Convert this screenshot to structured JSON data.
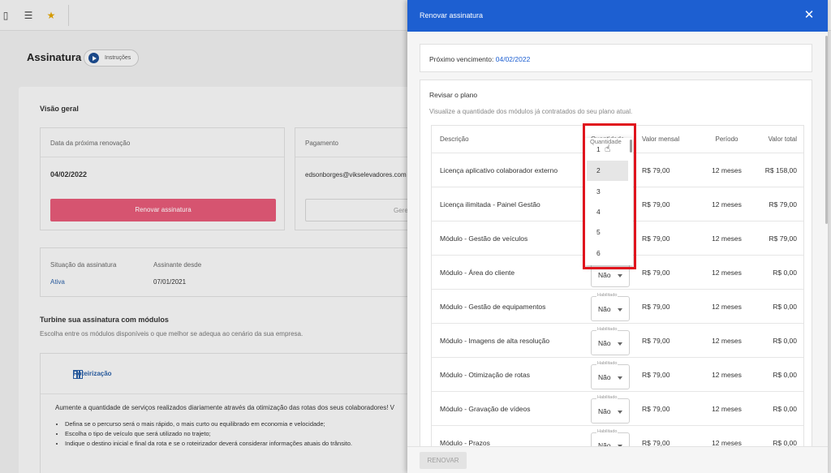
{
  "background": {
    "page_title": "Assinatura",
    "instructions_label": "Instruções",
    "overview": {
      "title": "Visão geral",
      "renewal_header": "Data da próxima renovação",
      "renewal_date": "04/02/2022",
      "renew_button": "Renovar assinatura",
      "payment_header": "Pagamento",
      "payment_email": "edsonborges@vikselevadores.com",
      "payment_button": "Gere"
    },
    "status": {
      "status_label": "Situação da assinatura",
      "status_value": "Ativa",
      "since_label": "Assinante desde",
      "since_value": "07/01/2021"
    },
    "modules": {
      "title": "Turbine sua assinatura com módulos",
      "subtitle": "Escolha entre os módulos disponíveis o que melhor se adequa ao cenário da sua empresa.",
      "routing_title": "Roteirização",
      "routing_desc": "Aumente a quantidade de serviços realizados diariamente através da otimização das rotas dos seus colaboradores! V",
      "bullets": [
        "Defina se o percurso será o mais rápido, o mais curto ou equilibrado em economia e velocidade;",
        "Escolha o tipo de veículo que será utilizado no trajeto;",
        "Indique o destino inicial e final da rota e se o roteirizador deverá considerar informações atuais do trânsito."
      ]
    }
  },
  "modal": {
    "title": "Renovar assinatura",
    "next_due_label": "Próximo vencimento:",
    "next_due_value": "04/02/2022",
    "review_title": "Revisar o plano",
    "review_subtitle": "Visualize a quantidade dos módulos já contratados do seu plano atual.",
    "columns": {
      "description": "Descrição",
      "quantity": "Quantidade",
      "monthly": "Valor mensal",
      "period": "Período",
      "total": "Valor total"
    },
    "select_label": "Habilitado",
    "rows": [
      {
        "desc": "Licença aplicativo colaborador externo",
        "qty": "",
        "monthly": "R$ 79,00",
        "period": "12 meses",
        "total": "R$ 158,00"
      },
      {
        "desc": "Licença ilimitada - Painel Gestão",
        "qty": "",
        "monthly": "R$ 79,00",
        "period": "12 meses",
        "total": "R$ 79,00"
      },
      {
        "desc": "Módulo - Gestão de veículos",
        "qty": "",
        "monthly": "R$ 79,00",
        "period": "12 meses",
        "total": "R$ 79,00"
      },
      {
        "desc": "Módulo - Área do cliente",
        "qty": "Não",
        "monthly": "R$ 79,00",
        "period": "12 meses",
        "total": "R$ 0,00"
      },
      {
        "desc": "Módulo - Gestão de equipamentos",
        "qty": "Não",
        "monthly": "R$ 79,00",
        "period": "12 meses",
        "total": "R$ 0,00"
      },
      {
        "desc": "Módulo - Imagens de alta resolução",
        "qty": "Não",
        "monthly": "R$ 79,00",
        "period": "12 meses",
        "total": "R$ 0,00"
      },
      {
        "desc": "Módulo - Otimização de rotas",
        "qty": "Não",
        "monthly": "R$ 79,00",
        "period": "12 meses",
        "total": "R$ 0,00"
      },
      {
        "desc": "Módulo - Gravação de vídeos",
        "qty": "Não",
        "monthly": "R$ 79,00",
        "period": "12 meses",
        "total": "R$ 0,00"
      },
      {
        "desc": "Módulo - Prazos",
        "qty": "Não",
        "monthly": "R$ 79,00",
        "period": "12 meses",
        "total": "R$ 0,00"
      }
    ],
    "dropdown": {
      "header": "Quantidade",
      "options": [
        "1",
        "2",
        "3",
        "4",
        "5",
        "6"
      ],
      "highlighted": "2"
    },
    "footer_button": "RENOVAR"
  },
  "colors": {
    "header_blue": "#1d5fd1",
    "renew_pink": "#e45a78",
    "highlight_red": "#e0141d"
  }
}
